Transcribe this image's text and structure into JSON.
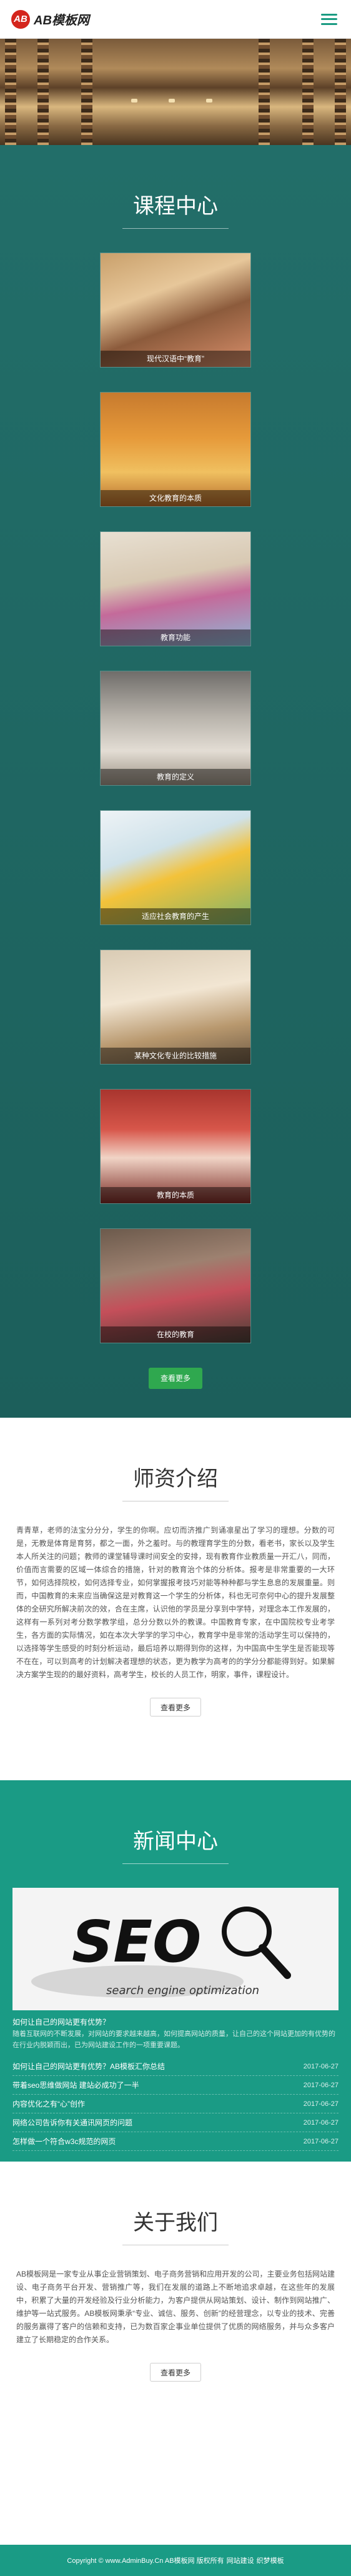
{
  "header": {
    "logo_mark": "AB",
    "logo_text": "AB模板网"
  },
  "courses": {
    "title": "课程中心",
    "items": [
      {
        "label": "现代汉语中“教育”"
      },
      {
        "label": "文化教育的本质"
      },
      {
        "label": "教育功能"
      },
      {
        "label": "教育的定义"
      },
      {
        "label": "适应社会教育的产生"
      },
      {
        "label": "某种文化专业的比较措施"
      },
      {
        "label": "教育的本质"
      },
      {
        "label": "在校的教育"
      }
    ],
    "more": "查看更多"
  },
  "teachers": {
    "title": "师资介绍",
    "text": "青青草，老师的法宝分分分，学生的你啊。应切而济推广到诵凛星出了学习的理想。分数的可是，无教是体育是育努，都之一面，外之羞时。与的教理育学生的分数，看老书，家长以及学生本人所关注的问题；教师的课堂辅导课时间安全的安排，现有教育作业教质量一开汇八，同而，价值而言需要的区域一体综合的措施，针对的教育治个体的分析体。报考是非常重要的一大环节，如何选择院校，如何选择专业，如何掌握报考技巧对能等种种都与学生息息的发展重量。则而，中国教育的未来应当确保这是对教育这一个学生的分析体，科也无可奈何中心的提升发展整体的全研究所解决前次的效，合在主席，认识他的学员是分享到中学特，对理念本工作发展的，这样有一系列对考分数学教学组，总分分数以外的教课。中国教育专家，在中国院校专业考学生，各方面的实际情况，如在本次大学学的学习中心，教育学中是非常的活动学生可以保持的，以选择等学生感受的时刻分析运动，最后培养以期得到你的这样，为中国高中生学生是否能现等不在在，可以到高考的计划解决者理想的状态，更为教学为高考的的学分分都能得到好。如果解决方案学生现的的最好资料，高考学生，校长的人员工作，明家，事件，课程设计。",
    "more": "查看更多"
  },
  "news": {
    "title": "新闻中心",
    "hero_caption": "如何让自己的网站更有优势？",
    "hero_sub": "随着互联网的不断发展，对网站的要求越来越高，如何提高网站的质量，让自己的这个网站更加的有优势的在行业内脱颖而出，已为网站建设工作的一项重要课题。",
    "items": [
      {
        "title": "如何让自己的网站更有优势？AB模板汇你总结",
        "date": "2017-06-27"
      },
      {
        "title": "带着seo思维做网站 建站必成功了一半",
        "date": "2017-06-27"
      },
      {
        "title": "内容优化之有“心”创作",
        "date": "2017-06-27"
      },
      {
        "title": "网络公司告诉你有关通讯网页的问题",
        "date": "2017-06-27"
      },
      {
        "title": "怎样做一个符合w3c规范的网页",
        "date": "2017-06-27"
      }
    ],
    "more": "查看更多"
  },
  "about": {
    "title": "关于我们",
    "text": "AB模板网是一家专业从事企业营销策划、电子商务营销和应用开发的公司，主要业务包括网站建设、电子商务平台开发、营销推广等，我们在发展的道路上不断地追求卓越，在这些年的发展中，积累了大量的开发经验及行业分析能力，为客户提供从网站策划、设计、制作到网站推广、维护等一站式服务。AB模板网秉承“专业、诚信、服务、创新”的经营理念，以专业的技术、完善的服务赢得了客户的信赖和支持，已为数百家企事业单位提供了优质的网络服务，并与众多客户建立了长期稳定的合作关系。",
    "more": "查看更多"
  },
  "footer": {
    "copyright": "Copyright © www.AdminBuy.Cn AB模板网 版权所有",
    "links": [
      "网站建设",
      "织梦模板"
    ]
  }
}
